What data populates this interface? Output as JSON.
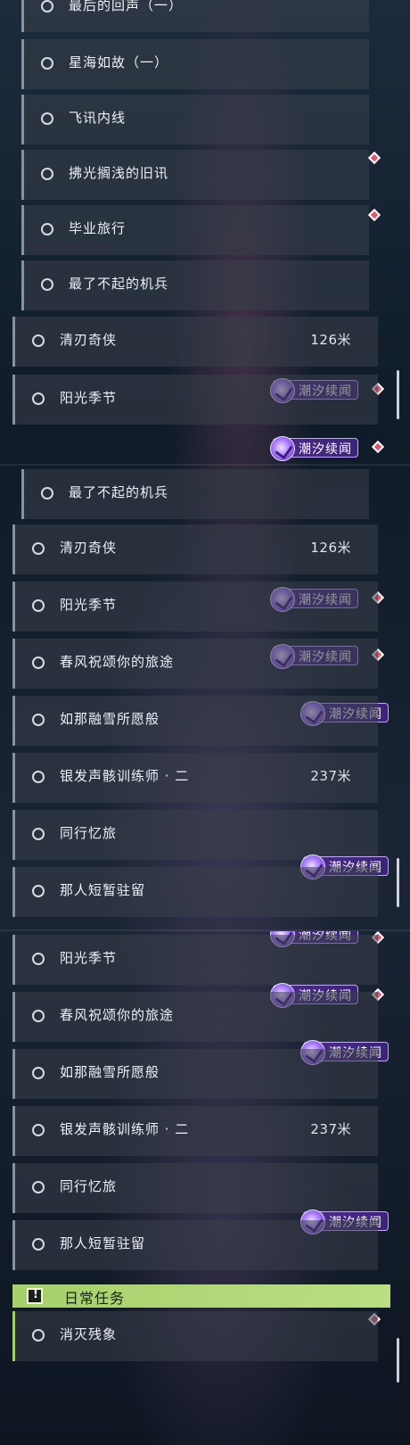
{
  "panels": [
    {
      "rows": [
        {
          "label": "最后的回声（一）",
          "distance": "",
          "indent": true
        },
        {
          "label": "星海如故（一）",
          "distance": "",
          "indent": true
        },
        {
          "label": "飞讯内线",
          "distance": "",
          "indent": true
        },
        {
          "label": "拂光搁浅的旧讯",
          "distance": "",
          "indent": true
        },
        {
          "label": "毕业旅行",
          "distance": "",
          "indent": true
        },
        {
          "label": "最了不起的机兵",
          "distance": "",
          "indent": true
        },
        {
          "label": "清刃奇侠",
          "distance": "126米",
          "indent": false
        },
        {
          "label": "阳光季节",
          "distance": "",
          "indent": false
        }
      ]
    },
    {
      "rows": [
        {
          "label": "最了不起的机兵",
          "distance": "",
          "indent": true
        },
        {
          "label": "清刃奇侠",
          "distance": "126米",
          "indent": false
        },
        {
          "label": "阳光季节",
          "distance": "",
          "indent": false
        },
        {
          "label": "春风祝颂你的旅途",
          "distance": "",
          "indent": false
        },
        {
          "label": "如那融雪所愿般",
          "distance": "",
          "indent": false
        },
        {
          "label": "银发声骸训练师 · 二",
          "distance": "237米",
          "indent": false
        },
        {
          "label": "同行忆旅",
          "distance": "",
          "indent": false
        },
        {
          "label": "那人短暂驻留",
          "distance": "",
          "indent": false
        }
      ]
    },
    {
      "rows": [
        {
          "label": "阳光季节",
          "distance": "",
          "indent": false
        },
        {
          "label": "春风祝颂你的旅途",
          "distance": "",
          "indent": false
        },
        {
          "label": "如那融雪所愿般",
          "distance": "",
          "indent": false
        },
        {
          "label": "银发声骸训练师 · 二",
          "distance": "237米",
          "indent": false
        },
        {
          "label": "同行忆旅",
          "distance": "",
          "indent": false
        },
        {
          "label": "那人短暂驻留",
          "distance": "",
          "indent": false
        },
        {
          "label": "消灭残象",
          "distance": "",
          "indent": false
        }
      ]
    }
  ],
  "badge_text": "潮汐续闻",
  "daily_section": {
    "title": "日常任务",
    "icon": "exclamation-icon"
  },
  "colors": {
    "accent_badge": "#4c2c8a",
    "badge_border": "#c2a7ff",
    "marker_red": "#e0556a",
    "daily_green": "#b9de83"
  },
  "icons": [
    "quest-circle-icon",
    "tide-emblem-icon",
    "tracking-diamond-icon",
    "exclamation-icon"
  ]
}
